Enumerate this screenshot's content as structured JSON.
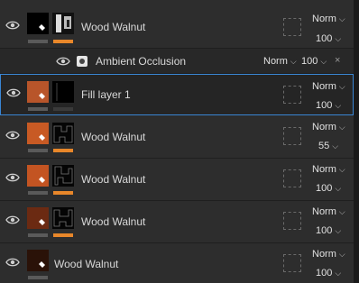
{
  "layers": [
    {
      "id": "row1",
      "name": "Wood Walnut",
      "blend": "Norm",
      "opacity": "100",
      "color": "#000000"
    },
    {
      "id": "ao",
      "name": "Ambient Occlusion",
      "blend": "Norm",
      "opacity": "100"
    },
    {
      "id": "row2",
      "name": "Fill layer 1",
      "blend": "Norm",
      "opacity": "100",
      "color": "#b8552a"
    },
    {
      "id": "row3",
      "name": "Wood Walnut",
      "blend": "Norm",
      "opacity": "55",
      "color": "#c85a24"
    },
    {
      "id": "row4",
      "name": "Wood Walnut",
      "blend": "Norm",
      "opacity": "100",
      "color": "#c35422"
    },
    {
      "id": "row5",
      "name": "Wood Walnut",
      "blend": "Norm",
      "opacity": "100",
      "color": "#6b2a12"
    },
    {
      "id": "row6",
      "name": "Wood Walnut",
      "blend": "Norm",
      "opacity": "100",
      "color": "#2a1208"
    }
  ],
  "close_glyph": "×",
  "chevron": "⌵",
  "colors": {
    "accent_orange": "#e8872a",
    "selection_border": "#3a86d4"
  }
}
